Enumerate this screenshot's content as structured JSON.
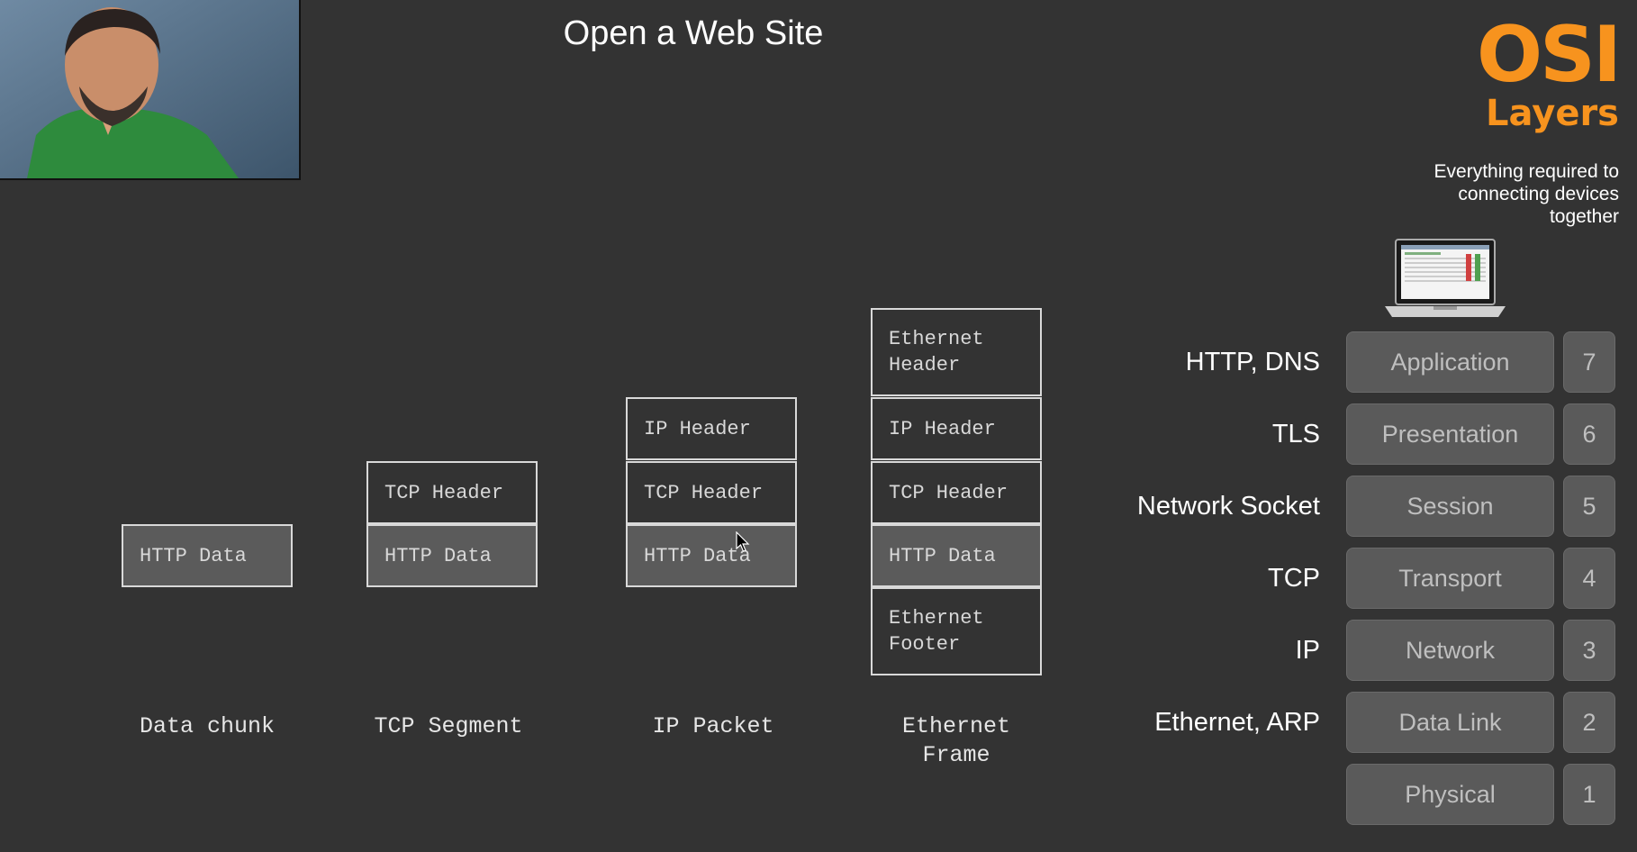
{
  "slide": {
    "title": "Open a Web Site"
  },
  "osi_panel": {
    "title": "OSI",
    "subtitle": "Layers",
    "description": "Everything required to connecting devices together",
    "accent_color": "#f7931e",
    "icon": "laptop-icon",
    "layers": [
      {
        "protocols": "HTTP, DNS",
        "name": "Application",
        "number": "7"
      },
      {
        "protocols": "TLS",
        "name": "Presentation",
        "number": "6"
      },
      {
        "protocols": "Network Socket",
        "name": "Session",
        "number": "5"
      },
      {
        "protocols": "TCP",
        "name": "Transport",
        "number": "4"
      },
      {
        "protocols": "IP",
        "name": "Network",
        "number": "3"
      },
      {
        "protocols": "Ethernet, ARP",
        "name": "Data Link",
        "number": "2"
      },
      {
        "protocols": "",
        "name": "Physical",
        "number": "1"
      }
    ]
  },
  "encapsulation": {
    "data_chunk": {
      "label": "Data chunk",
      "blocks": [
        "HTTP Data"
      ]
    },
    "tcp_segment": {
      "label": "TCP Segment",
      "blocks": [
        "TCP Header",
        "HTTP Data"
      ]
    },
    "ip_packet": {
      "label": "IP Packet",
      "blocks": [
        "IP Header",
        "TCP Header",
        "HTTP Data"
      ]
    },
    "ethernet_frame": {
      "label": "Ethernet\nFrame",
      "blocks": [
        "Ethernet\nHeader",
        "IP Header",
        "TCP Header",
        "HTTP Data",
        "Ethernet\nFooter"
      ]
    }
  }
}
